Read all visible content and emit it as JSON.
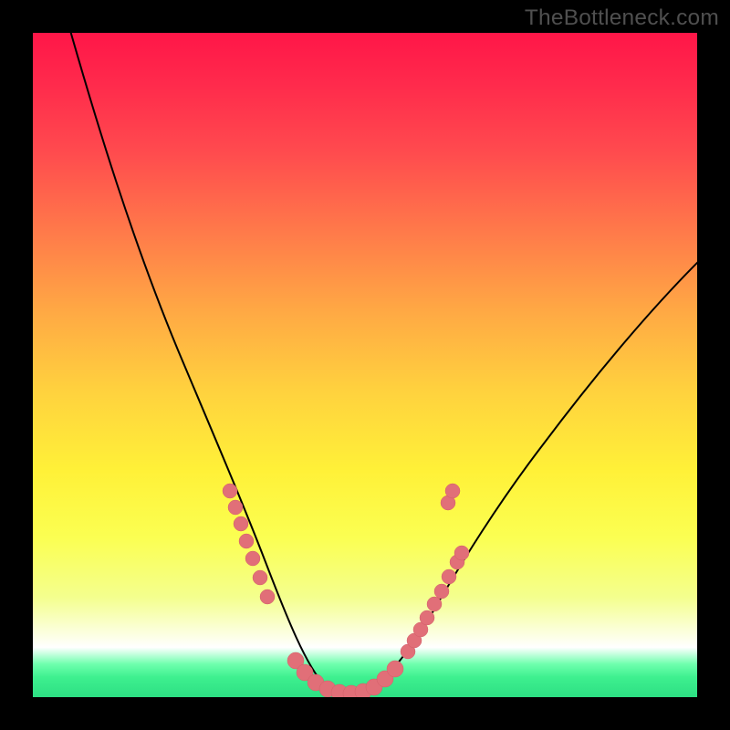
{
  "watermark": "TheBottleneck.com",
  "colors": {
    "frame_bg": "#000000",
    "curve": "#000000",
    "marker_fill": "#e16f78",
    "marker_stroke": "#d25e68",
    "gradient_top": "#ff1648",
    "gradient_mid": "#fff138",
    "gradient_bottom": "#2ddf83"
  },
  "chart_data": {
    "type": "line",
    "title": "",
    "xlabel": "",
    "ylabel": "",
    "xlim": [
      0,
      100
    ],
    "ylim": [
      0,
      100
    ],
    "note": "V-shaped bottleneck curve. y≈100 means severe bottleneck (red), y≈0 means balanced (green). Axis values are positional estimates read off the image (no ticks/labels visible).",
    "series": [
      {
        "name": "bottleneck-curve",
        "x": [
          5,
          10,
          15,
          20,
          25,
          29,
          31,
          33,
          35,
          37,
          39,
          41,
          43,
          45,
          48,
          50,
          53,
          55,
          58,
          62,
          68,
          75,
          82,
          90,
          100
        ],
        "y": [
          100,
          82,
          66,
          52,
          40,
          30,
          25,
          20,
          14,
          9,
          5,
          2,
          1,
          0.5,
          0.5,
          1,
          2.5,
          4,
          7,
          12,
          20,
          28,
          36,
          44,
          53
        ]
      }
    ],
    "markers": {
      "name": "sample-points",
      "x": [
        29,
        30,
        31,
        32,
        33,
        34,
        35,
        39,
        40,
        42,
        44,
        45,
        47,
        48,
        50,
        51,
        53,
        55,
        56,
        57,
        58,
        59,
        60,
        61
      ],
      "y": [
        30,
        27,
        25,
        22,
        20,
        17,
        14,
        5,
        4,
        2,
        1,
        0.8,
        0.6,
        0.6,
        1,
        1.5,
        2.5,
        4,
        5,
        6,
        7,
        8.5,
        10,
        11.5
      ]
    }
  }
}
